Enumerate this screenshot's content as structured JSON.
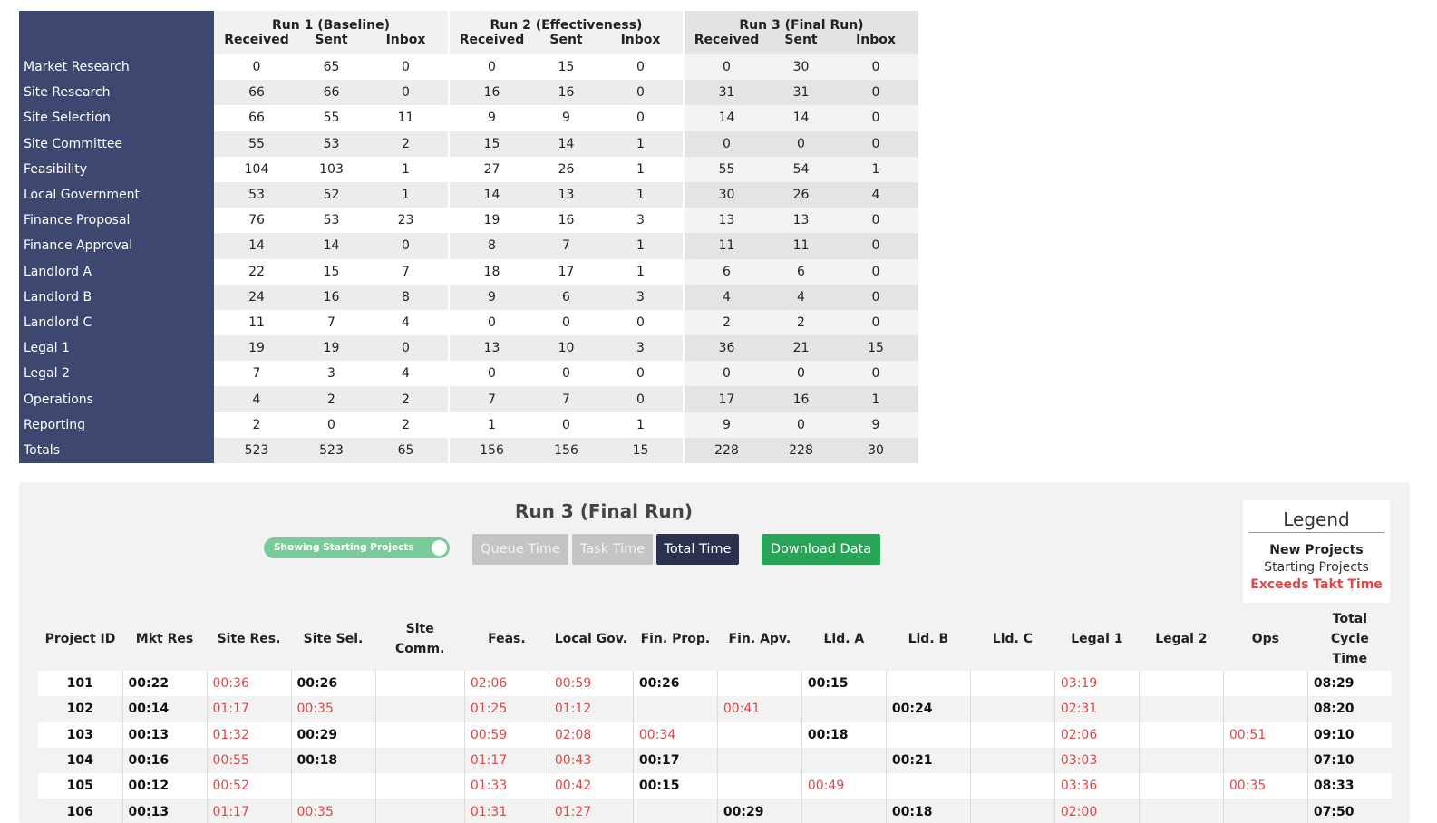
{
  "summary": {
    "runs": [
      "Run 1 (Baseline)",
      "Run 2 (Effectiveness)",
      "Run 3 (Final Run)"
    ],
    "subheaders": [
      "Received",
      "Sent",
      "Inbox"
    ],
    "rows": [
      {
        "label": "Market Research",
        "values": [
          "0",
          "65",
          "0",
          "0",
          "15",
          "0",
          "0",
          "30",
          "0"
        ]
      },
      {
        "label": "Site Research",
        "values": [
          "66",
          "66",
          "0",
          "16",
          "16",
          "0",
          "31",
          "31",
          "0"
        ]
      },
      {
        "label": "Site Selection",
        "values": [
          "66",
          "55",
          "11",
          "9",
          "9",
          "0",
          "14",
          "14",
          "0"
        ]
      },
      {
        "label": "Site Committee",
        "values": [
          "55",
          "53",
          "2",
          "15",
          "14",
          "1",
          "0",
          "0",
          "0"
        ]
      },
      {
        "label": "Feasibility",
        "values": [
          "104",
          "103",
          "1",
          "27",
          "26",
          "1",
          "55",
          "54",
          "1"
        ]
      },
      {
        "label": "Local Government",
        "values": [
          "53",
          "52",
          "1",
          "14",
          "13",
          "1",
          "30",
          "26",
          "4"
        ]
      },
      {
        "label": "Finance Proposal",
        "values": [
          "76",
          "53",
          "23",
          "19",
          "16",
          "3",
          "13",
          "13",
          "0"
        ]
      },
      {
        "label": "Finance Approval",
        "values": [
          "14",
          "14",
          "0",
          "8",
          "7",
          "1",
          "11",
          "11",
          "0"
        ]
      },
      {
        "label": "Landlord A",
        "values": [
          "22",
          "15",
          "7",
          "18",
          "17",
          "1",
          "6",
          "6",
          "0"
        ]
      },
      {
        "label": "Landlord B",
        "values": [
          "24",
          "16",
          "8",
          "9",
          "6",
          "3",
          "4",
          "4",
          "0"
        ]
      },
      {
        "label": "Landlord C",
        "values": [
          "11",
          "7",
          "4",
          "0",
          "0",
          "0",
          "2",
          "2",
          "0"
        ]
      },
      {
        "label": "Legal 1",
        "values": [
          "19",
          "19",
          "0",
          "13",
          "10",
          "3",
          "36",
          "21",
          "15"
        ]
      },
      {
        "label": "Legal 2",
        "values": [
          "7",
          "3",
          "4",
          "0",
          "0",
          "0",
          "0",
          "0",
          "0"
        ]
      },
      {
        "label": "Operations",
        "values": [
          "4",
          "2",
          "2",
          "7",
          "7",
          "0",
          "17",
          "16",
          "1"
        ]
      },
      {
        "label": "Reporting",
        "values": [
          "2",
          "0",
          "2",
          "1",
          "0",
          "1",
          "9",
          "0",
          "9"
        ]
      },
      {
        "label": "Totals",
        "values": [
          "523",
          "523",
          "65",
          "156",
          "156",
          "15",
          "228",
          "228",
          "30"
        ]
      }
    ]
  },
  "panel": {
    "title": "Run 3 (Final Run)",
    "toggle_label": "Showing Starting Projects",
    "buttons": {
      "queue": "Queue Time",
      "task": "Task Time",
      "total": "Total Time",
      "download": "Download Data"
    },
    "legend": {
      "title": "Legend",
      "new": "New Projects",
      "starting": "Starting Projects",
      "exceeds": "Exceeds Takt Time"
    },
    "colors": {
      "late": "#e04646",
      "active_button": "#2c3150",
      "download_button": "#28a457",
      "toggle": "#7bcb9a",
      "sidebar": "#3e476f"
    }
  },
  "times": {
    "headers": [
      "Project ID",
      "Mkt Res",
      "Site Res.",
      "Site Sel.",
      "Site Comm.",
      "Feas.",
      "Local Gov.",
      "Fin. Prop.",
      "Fin. Apv.",
      "Lld. A",
      "Lld. B",
      "Lld. C",
      "Legal 1",
      "Legal 2",
      "Ops",
      "Total Cycle Time"
    ],
    "rows": [
      {
        "id": "101",
        "cells": [
          [
            "00:22",
            0
          ],
          [
            "00:36",
            1
          ],
          [
            "00:26",
            0
          ],
          [
            "",
            0
          ],
          [
            "02:06",
            1
          ],
          [
            "00:59",
            1
          ],
          [
            "00:26",
            0
          ],
          [
            "",
            0
          ],
          [
            "00:15",
            0
          ],
          [
            "",
            0
          ],
          [
            "",
            0
          ],
          [
            "03:19",
            1
          ],
          [
            "",
            0
          ],
          [
            "",
            0
          ],
          [
            "08:29",
            0
          ]
        ]
      },
      {
        "id": "102",
        "cells": [
          [
            "00:14",
            0
          ],
          [
            "01:17",
            1
          ],
          [
            "00:35",
            1
          ],
          [
            "",
            0
          ],
          [
            "01:25",
            1
          ],
          [
            "01:12",
            1
          ],
          [
            "",
            0
          ],
          [
            "00:41",
            1
          ],
          [
            "",
            0
          ],
          [
            "00:24",
            0
          ],
          [
            "",
            0
          ],
          [
            "02:31",
            1
          ],
          [
            "",
            0
          ],
          [
            "",
            0
          ],
          [
            "08:20",
            0
          ]
        ]
      },
      {
        "id": "103",
        "cells": [
          [
            "00:13",
            0
          ],
          [
            "01:32",
            1
          ],
          [
            "00:29",
            0
          ],
          [
            "",
            0
          ],
          [
            "00:59",
            1
          ],
          [
            "02:08",
            1
          ],
          [
            "00:34",
            1
          ],
          [
            "",
            0
          ],
          [
            "00:18",
            0
          ],
          [
            "",
            0
          ],
          [
            "",
            0
          ],
          [
            "02:06",
            1
          ],
          [
            "",
            0
          ],
          [
            "00:51",
            1
          ],
          [
            "09:10",
            0
          ]
        ]
      },
      {
        "id": "104",
        "cells": [
          [
            "00:16",
            0
          ],
          [
            "00:55",
            1
          ],
          [
            "00:18",
            0
          ],
          [
            "",
            0
          ],
          [
            "01:17",
            1
          ],
          [
            "00:43",
            1
          ],
          [
            "00:17",
            0
          ],
          [
            "",
            0
          ],
          [
            "",
            0
          ],
          [
            "00:21",
            0
          ],
          [
            "",
            0
          ],
          [
            "03:03",
            1
          ],
          [
            "",
            0
          ],
          [
            "",
            0
          ],
          [
            "07:10",
            0
          ]
        ]
      },
      {
        "id": "105",
        "cells": [
          [
            "00:12",
            0
          ],
          [
            "00:52",
            1
          ],
          [
            "",
            0
          ],
          [
            "",
            0
          ],
          [
            "01:33",
            1
          ],
          [
            "00:42",
            1
          ],
          [
            "00:15",
            0
          ],
          [
            "",
            0
          ],
          [
            "00:49",
            1
          ],
          [
            "",
            0
          ],
          [
            "",
            0
          ],
          [
            "03:36",
            1
          ],
          [
            "",
            0
          ],
          [
            "00:35",
            1
          ],
          [
            "08:33",
            0
          ]
        ]
      },
      {
        "id": "106",
        "cells": [
          [
            "00:13",
            0
          ],
          [
            "01:17",
            1
          ],
          [
            "00:35",
            1
          ],
          [
            "",
            0
          ],
          [
            "01:31",
            1
          ],
          [
            "01:27",
            1
          ],
          [
            "",
            0
          ],
          [
            "00:29",
            0
          ],
          [
            "",
            0
          ],
          [
            "00:18",
            0
          ],
          [
            "",
            0
          ],
          [
            "02:00",
            1
          ],
          [
            "",
            0
          ],
          [
            "",
            0
          ],
          [
            "07:50",
            0
          ]
        ]
      }
    ]
  }
}
